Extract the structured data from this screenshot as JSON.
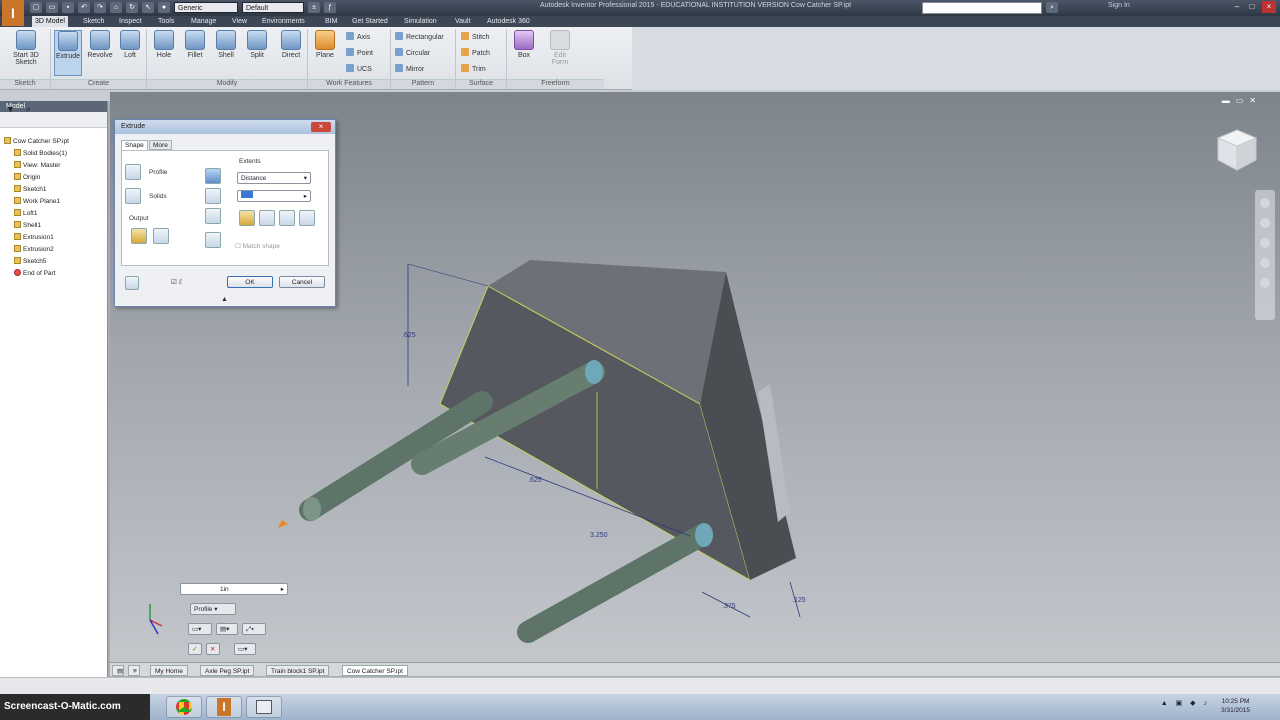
{
  "app": {
    "title": "Autodesk Inventor Professional 2015 - EDUCATIONAL INSTITUTION VERSION   Cow Catcher SP.ipt",
    "appearance_select": "Generic",
    "material_select": "Default",
    "sign_in": "Sign In"
  },
  "menu_tabs": [
    "3D Model",
    "Sketch",
    "Inspect",
    "Tools",
    "Manage",
    "View",
    "Environments",
    "BIM",
    "Get Started",
    "Simulation",
    "Vault",
    "Autodesk 360"
  ],
  "ribbon": {
    "start_sketch": "Start 3D Sketch",
    "create": [
      "Extrude",
      "Revolve",
      "Loft"
    ],
    "modify": [
      "Hole",
      "Fillet",
      "Shell",
      "Split"
    ],
    "direct": "Direct",
    "plane": "Plane",
    "work_small": [
      "Axis",
      "Point",
      "UCS"
    ],
    "pattern_small": [
      "Rectangular",
      "Circular",
      "Mirror"
    ],
    "surface_small": [
      "Stitch",
      "Patch",
      "Trim"
    ],
    "box": "Box",
    "edit_form": "Edit Form",
    "groups": {
      "sketch": "Sketch",
      "create": "Create",
      "modify": "Modify",
      "work": "Work Features",
      "pattern": "Pattern",
      "surface": "Surface",
      "freeform": "Freeform"
    }
  },
  "browser": {
    "header": "Model",
    "items": [
      "Cow Catcher SP.ipt",
      "Solid Bodies(1)",
      "View: Master",
      "Origin",
      "Sketch1",
      "Work Plane1",
      "Loft1",
      "Shell1",
      "Extrusion1",
      "Extrusion2",
      "Sketch5",
      "End of Part"
    ]
  },
  "dialog": {
    "title": "Extrude",
    "tabs": [
      "Shape",
      "More"
    ],
    "profile": "Profile",
    "solids": "Solids",
    "output": "Output",
    "extents": "Extents",
    "extent_value": "Distance",
    "match_shape": "Match shape",
    "ok": "OK",
    "cancel": "Cancel"
  },
  "viewport": {
    "dimensions": [
      ".625",
      ".625",
      "3.250",
      ".375",
      ".125"
    ],
    "mini_toolbar": {
      "distance": "1in",
      "profile": "Profile"
    }
  },
  "doc_tabs": [
    "My Home",
    "Axle Peg SP.ipt",
    "Train block1 SP.ipt",
    "Cow Catcher SP.ipt"
  ],
  "taskbar": {
    "logo": "Screencast-O-Matic.com",
    "time": "10:25 PM",
    "date": "3/31/2015"
  }
}
